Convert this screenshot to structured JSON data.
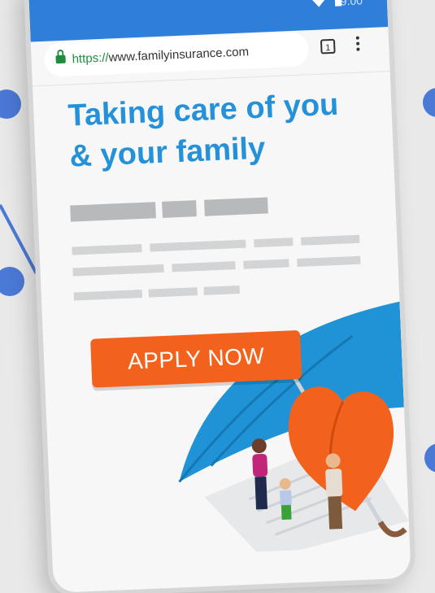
{
  "browser": {
    "url_scheme": "https://",
    "url_host": "www.familyinsurance.com",
    "tab_count": "1",
    "status_time": "9:00"
  },
  "page": {
    "headline_line1": "Taking care of you",
    "headline_line2": "& your family",
    "cta_label": "APPLY NOW"
  },
  "icons": {
    "lock": "lock-icon",
    "tabs": "tab-count-icon",
    "menu": "more-vert-icon",
    "signal": "signal-icon",
    "battery": "battery-icon"
  },
  "colors": {
    "status_bar": "#2f7fd8",
    "headline": "#2591d9",
    "cta": "#f2621c",
    "umbrella": "#1f93d6",
    "heart": "#f2621c",
    "accent_dots": "#4a79d6"
  }
}
